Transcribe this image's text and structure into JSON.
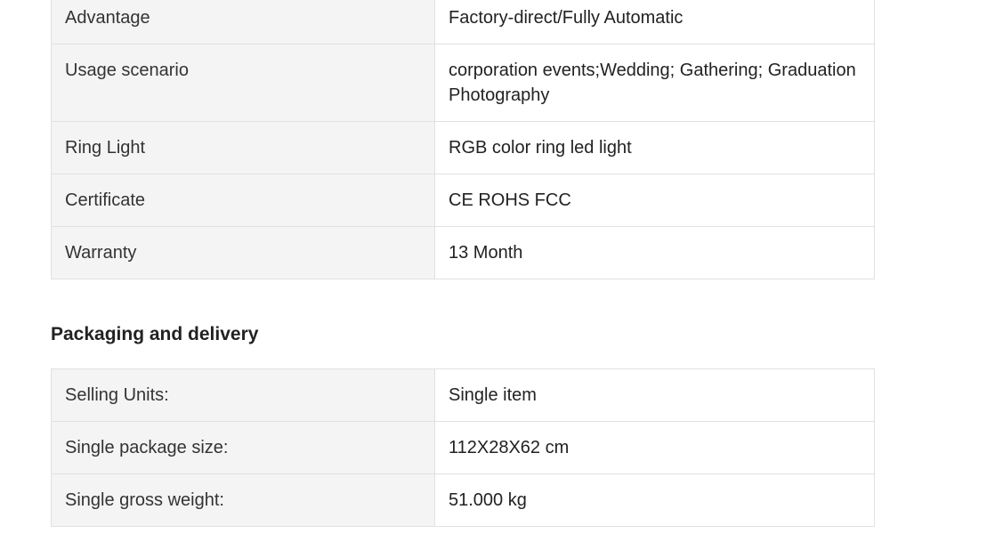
{
  "attributes": {
    "rows": [
      {
        "label": "",
        "value": ""
      },
      {
        "label": "Advantage",
        "value": "Factory-direct/Fully Automatic"
      },
      {
        "label": "Usage scenario",
        "value": "corporation events;Wedding; Gathering; Graduation Photography"
      },
      {
        "label": "Ring Light",
        "value": "RGB color ring led light"
      },
      {
        "label": "Certificate",
        "value": "CE ROHS FCC"
      },
      {
        "label": "Warranty",
        "value": "13 Month"
      }
    ]
  },
  "packaging": {
    "title": "Packaging and delivery",
    "rows": [
      {
        "label": "Selling Units:",
        "value": "Single item"
      },
      {
        "label": "Single package size:",
        "value": "112X28X62 cm"
      },
      {
        "label": "Single gross weight:",
        "value": "51.000 kg"
      }
    ]
  }
}
